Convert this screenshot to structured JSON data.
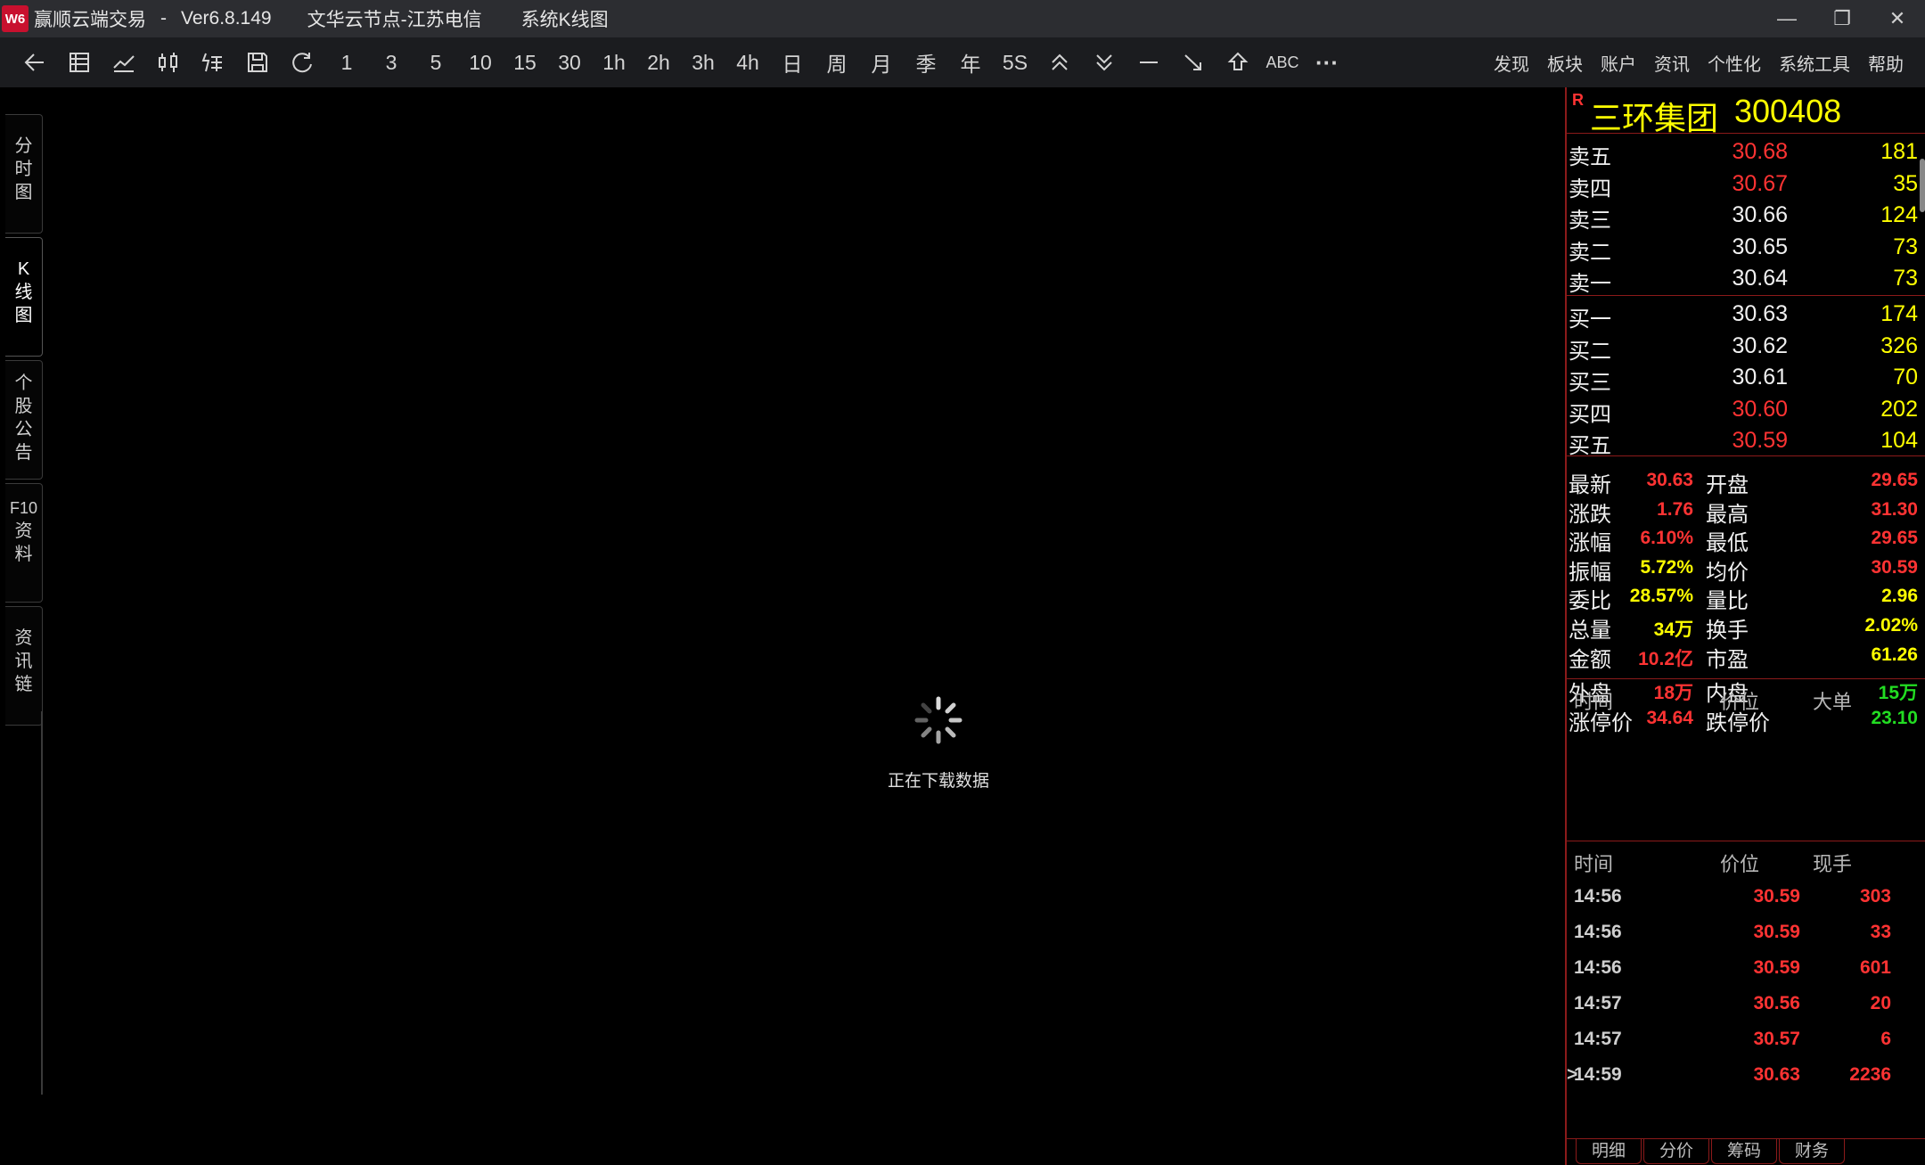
{
  "titlebar": {
    "logo": "W6",
    "app_name": "赢顺云端交易",
    "sep": "-",
    "version": "Ver6.8.149",
    "server_node": "文华云节点-江苏电信",
    "window_mode": "系统K线图",
    "min": "—",
    "max": "❐",
    "close": "✕"
  },
  "toolbar": {
    "periods": [
      "1",
      "3",
      "5",
      "10",
      "15",
      "30",
      "1h",
      "2h",
      "3h",
      "4h",
      "日",
      "周",
      "月",
      "季",
      "年",
      "5S"
    ],
    "abc": "ABC",
    "more": "···",
    "menu": [
      "发现",
      "板块",
      "账户",
      "资讯",
      "个性化",
      "系统工具",
      "帮助"
    ]
  },
  "left_tabs": [
    {
      "chars": [
        "分",
        "时",
        "图"
      ],
      "active": false
    },
    {
      "chars": [
        "K",
        "线",
        "图"
      ],
      "active": true
    },
    {
      "chars": [
        "个",
        "股",
        "公",
        "告"
      ],
      "active": false
    },
    {
      "chars": [
        "F10",
        "资",
        "料"
      ],
      "active": false
    },
    {
      "chars": [
        "资",
        "讯",
        "链"
      ],
      "active": false
    }
  ],
  "loading": {
    "text": "正在下载数据"
  },
  "stock": {
    "marker": "R",
    "name": "三环集团",
    "code": "300408"
  },
  "orderbook": {
    "asks": [
      {
        "label": "卖五",
        "price": "30.68",
        "vol": "181",
        "color": "#ff3333"
      },
      {
        "label": "卖四",
        "price": "30.67",
        "vol": "35",
        "color": "#ff3333"
      },
      {
        "label": "卖三",
        "price": "30.66",
        "vol": "124",
        "color": "#f0f0f0"
      },
      {
        "label": "卖二",
        "price": "30.65",
        "vol": "73",
        "color": "#f0f0f0"
      },
      {
        "label": "卖一",
        "price": "30.64",
        "vol": "73",
        "color": "#f0f0f0"
      }
    ],
    "bids": [
      {
        "label": "买一",
        "price": "30.63",
        "vol": "174",
        "color": "#f0f0f0"
      },
      {
        "label": "买二",
        "price": "30.62",
        "vol": "326",
        "color": "#f0f0f0"
      },
      {
        "label": "买三",
        "price": "30.61",
        "vol": "70",
        "color": "#f0f0f0"
      },
      {
        "label": "买四",
        "price": "30.60",
        "vol": "202",
        "color": "#ff3333"
      },
      {
        "label": "买五",
        "price": "30.59",
        "vol": "104",
        "color": "#ff3333"
      }
    ]
  },
  "stats": [
    [
      {
        "label": "最新",
        "value": "30.63",
        "color": "#ff3333"
      },
      {
        "label": "开盘",
        "value": "29.65",
        "color": "#ff3333"
      }
    ],
    [
      {
        "label": "涨跌",
        "value": "1.76",
        "color": "#ff3333"
      },
      {
        "label": "最高",
        "value": "31.30",
        "color": "#ff3333"
      }
    ],
    [
      {
        "label": "涨幅",
        "value": "6.10%",
        "color": "#ff3333"
      },
      {
        "label": "最低",
        "value": "29.65",
        "color": "#ff3333"
      }
    ],
    [
      {
        "label": "振幅",
        "value": "5.72%",
        "color": "#ffff00"
      },
      {
        "label": "均价",
        "value": "30.59",
        "color": "#ff3333"
      }
    ],
    [
      {
        "label": "委比",
        "value": "28.57%",
        "color": "#ffff00"
      },
      {
        "label": "量比",
        "value": "2.96",
        "color": "#ffff00"
      }
    ],
    [
      {
        "label": "总量",
        "value": "34万",
        "color": "#ffff00"
      },
      {
        "label": "换手",
        "value": "2.02%",
        "color": "#ffff00"
      }
    ],
    [
      {
        "label": "金额",
        "value": "10.2亿",
        "color": "#ff3333"
      },
      {
        "label": "市盈",
        "value": "61.26",
        "color": "#ffff00"
      }
    ],
    [
      {
        "label": "外盘",
        "value": "18万",
        "color": "#ff3333"
      },
      {
        "label": "内盘",
        "value": "15万",
        "color": "#22dd22"
      }
    ],
    [
      {
        "label": "涨停价",
        "value": "34.64",
        "color": "#ff3333"
      },
      {
        "label": "跌停价",
        "value": "23.10",
        "color": "#22dd22"
      }
    ]
  ],
  "bigorders": {
    "headers": [
      "时间",
      "价位",
      "大单"
    ]
  },
  "ticks": {
    "headers": [
      "时间",
      "价位",
      "现手"
    ],
    "marker": ">",
    "rows": [
      {
        "time": "14:56",
        "price": "30.59",
        "vol": "303"
      },
      {
        "time": "14:56",
        "price": "30.59",
        "vol": "33"
      },
      {
        "time": "14:56",
        "price": "30.59",
        "vol": "601"
      },
      {
        "time": "14:57",
        "price": "30.56",
        "vol": "20"
      },
      {
        "time": "14:57",
        "price": "30.57",
        "vol": "6"
      },
      {
        "time": "14:59",
        "price": "30.63",
        "vol": "2236"
      }
    ]
  },
  "bottom_tabs": [
    "明细",
    "分价",
    "筹码",
    "财务"
  ]
}
